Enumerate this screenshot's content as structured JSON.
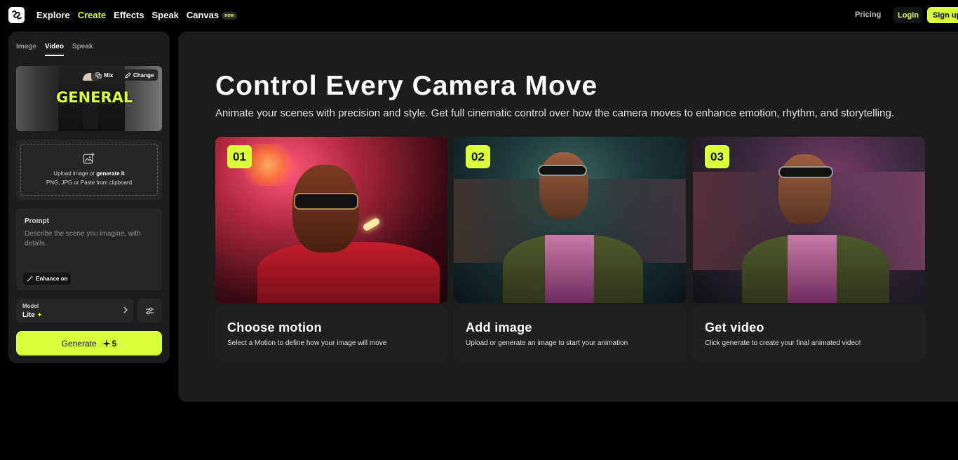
{
  "nav": {
    "items": [
      "Explore",
      "Create",
      "Effects",
      "Speak",
      "Canvas"
    ],
    "active": "Create",
    "canvas_badge": "new",
    "pricing": "Pricing",
    "login": "Login",
    "signup": "Sign up"
  },
  "panel": {
    "tabs": [
      "Image",
      "Video",
      "Speak"
    ],
    "active_tab": "Video",
    "preview": {
      "text": "GENERAL",
      "mix": "Mix",
      "change": "Change"
    },
    "upload": {
      "line1_pre": "Upload image or ",
      "line1_link": "generate it",
      "line2": "PNG, JPG or Paste from clipboard"
    },
    "prompt": {
      "label": "Prompt",
      "placeholder": "Describe the scene you imagine, with details.",
      "enhance": "Enhance on"
    },
    "model": {
      "label": "Model",
      "value": "Lite"
    },
    "generate": {
      "label": "Generate",
      "cost": "5"
    }
  },
  "main": {
    "title": "Control Every Camera Move",
    "subtitle": "Animate your scenes with precision and style. Get full cinematic control over how the camera moves to enhance emotion, rhythm, and storytelling.",
    "cards": [
      {
        "num": "01",
        "title": "Choose motion",
        "desc": "Select a Motion to define how your image will move"
      },
      {
        "num": "02",
        "title": "Add image",
        "desc": "Upload or generate an image to start your animation"
      },
      {
        "num": "03",
        "title": "Get video",
        "desc": "Click generate to create your final animated video!"
      }
    ]
  },
  "colors": {
    "accent": "#d9ff3b",
    "panel": "#1c1c1c",
    "background": "#000000"
  }
}
